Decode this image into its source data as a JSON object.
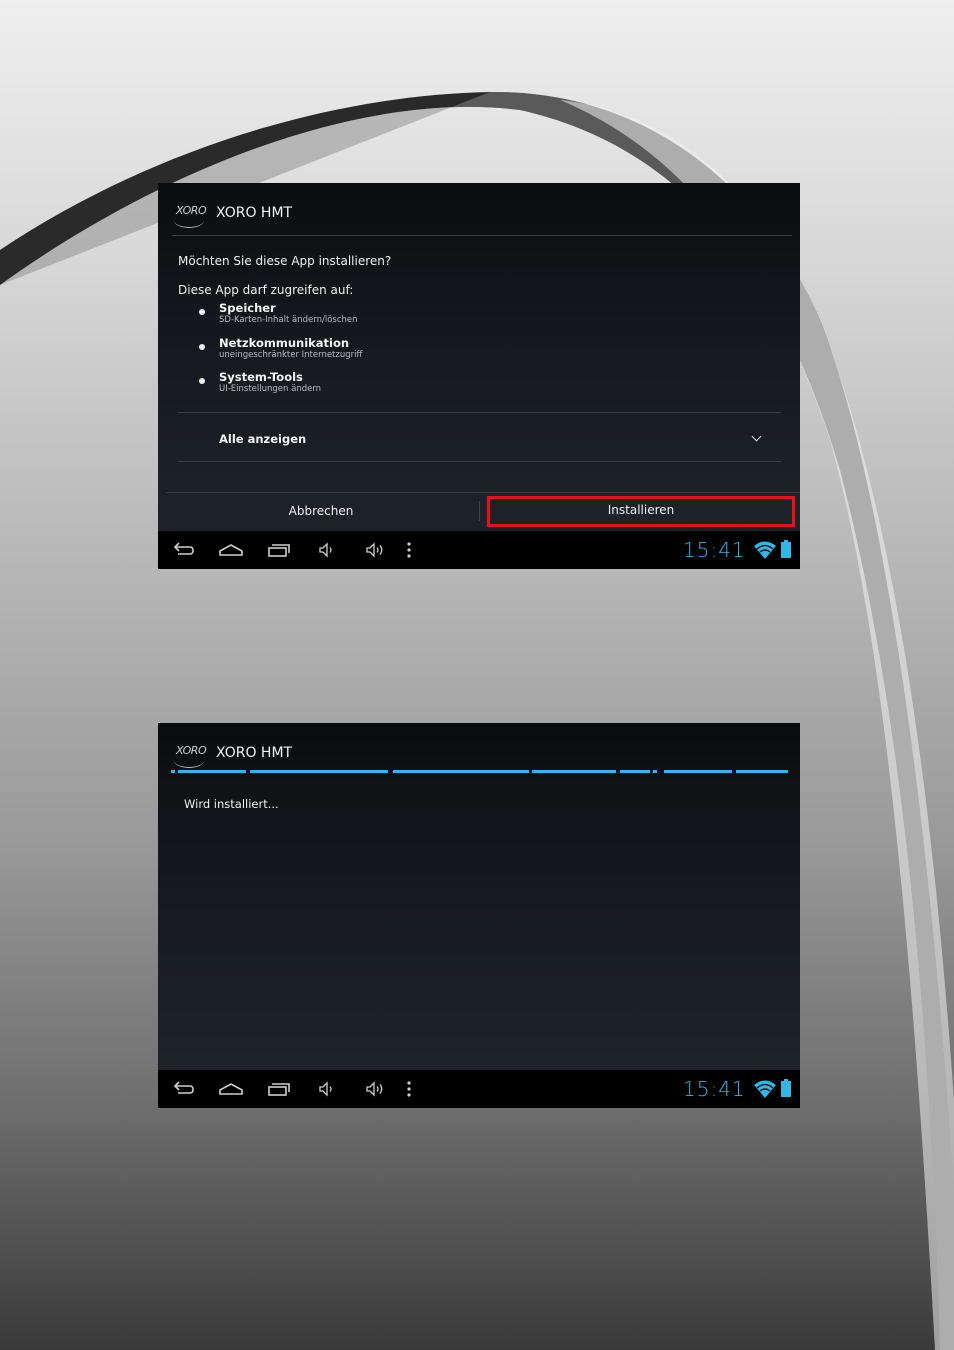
{
  "screen1": {
    "app_title": "XORO HMT",
    "logo_text": "XORO",
    "question": "Möchten Sie diese App installieren?",
    "access_heading": "Diese App darf zugreifen auf:",
    "permissions": [
      {
        "title": "Speicher",
        "desc": "SD-Karten-Inhalt ändern/löschen"
      },
      {
        "title": "Netzkommunikation",
        "desc": "uneingeschränkter Internetzugriff"
      },
      {
        "title": "System-Tools",
        "desc": "UI-Einstellungen ändern"
      }
    ],
    "show_all": "Alle anzeigen",
    "cancel_label": "Abbrechen",
    "install_label": "Installieren",
    "clock": "15:41"
  },
  "screen2": {
    "app_title": "XORO HMT",
    "logo_text": "XORO",
    "status": "Wird installiert...",
    "clock": "15:41"
  },
  "colors": {
    "accent": "#33b5e5",
    "highlight": "#e0141b",
    "navbar": "#000000"
  },
  "icons": [
    "back-icon",
    "home-icon",
    "recent-apps-icon",
    "volume-down-icon",
    "volume-up-icon",
    "menu-icon",
    "wifi-icon",
    "battery-icon"
  ]
}
